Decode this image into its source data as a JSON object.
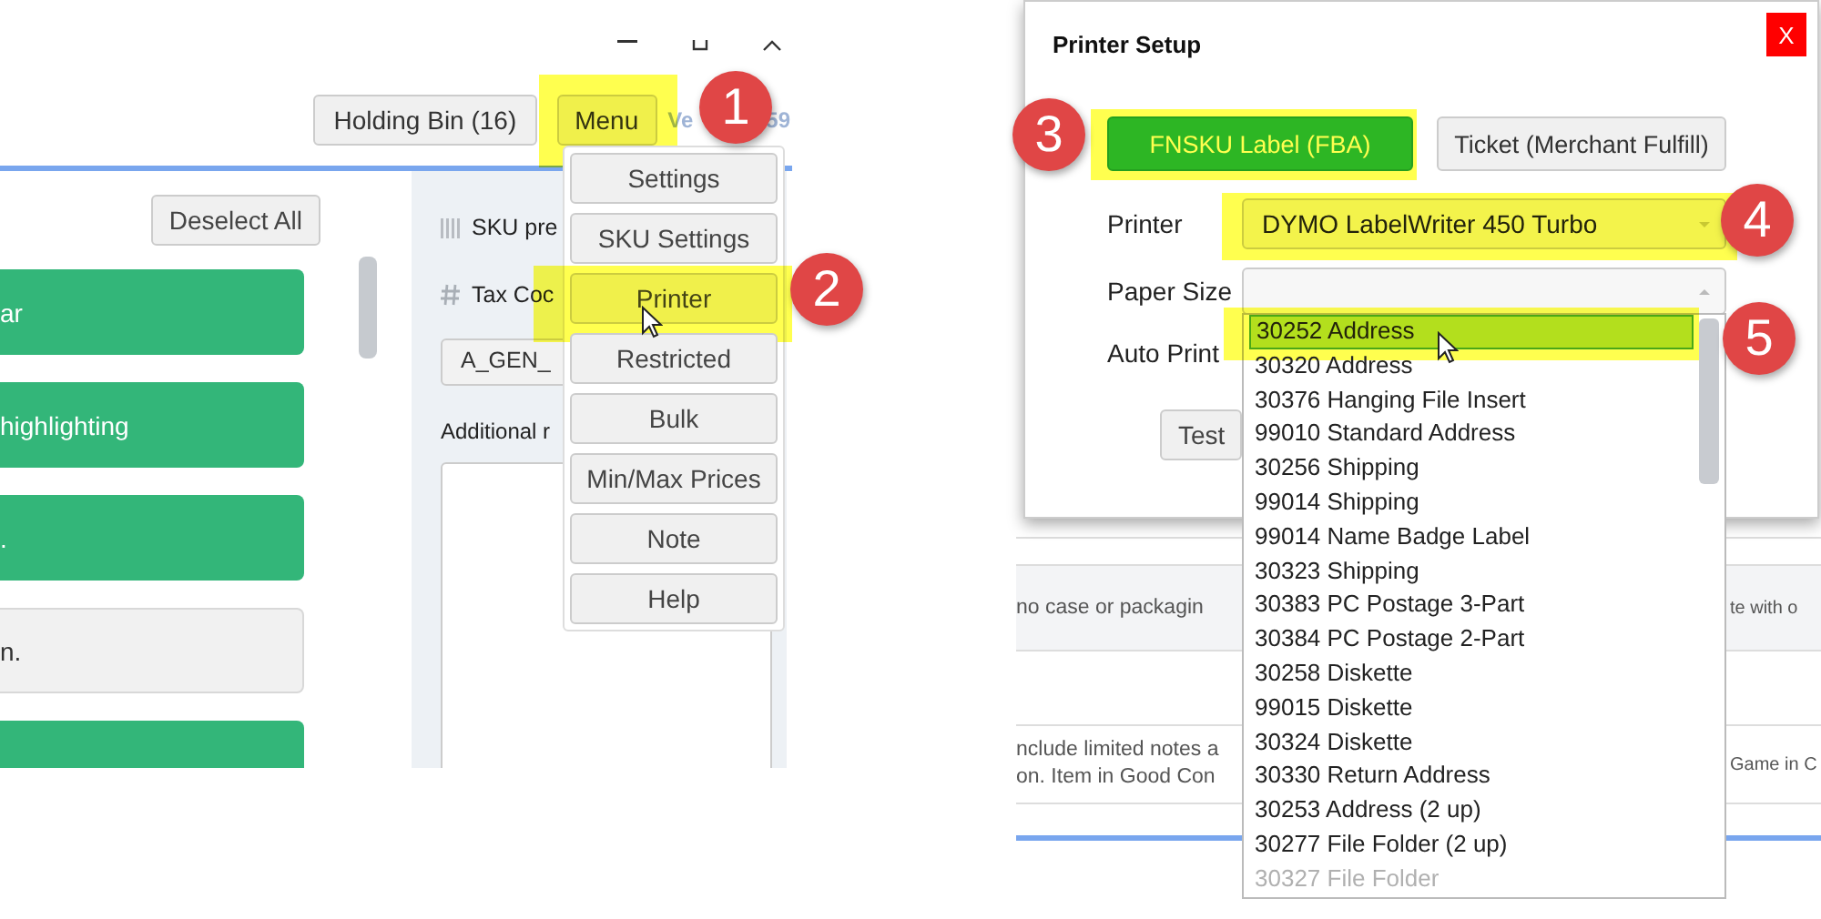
{
  "left_window": {
    "toolbar": {
      "buttons": [
        {
          "label": "Holding Bin (16)",
          "highlighted": false
        },
        {
          "label": "Menu",
          "highlighted": true
        }
      ],
      "version_text": [
        "Ve",
        "59"
      ]
    },
    "deselect_button": "Deselect All",
    "list_items": [
      {
        "text": "ar",
        "selected": true
      },
      {
        "text": "highlighting",
        "selected": true
      },
      {
        "text": ".",
        "selected": true
      },
      {
        "text": "n.",
        "selected": false
      },
      {
        "selected": true
      }
    ],
    "form": {
      "sku_label": "SKU pre",
      "tax_label": "Tax Coc",
      "tax_code_value": "A_GEN_",
      "notes_label": "Additional r"
    },
    "menu": {
      "items": [
        {
          "label": "Settings",
          "highlighted": false
        },
        {
          "label": "SKU Settings",
          "highlighted": false
        },
        {
          "label": "Printer",
          "highlighted": true
        },
        {
          "label": "Restricted",
          "highlighted": false
        },
        {
          "label": "Bulk",
          "highlighted": false
        },
        {
          "label": "Min/Max Prices",
          "highlighted": false
        },
        {
          "label": "Note",
          "highlighted": false
        },
        {
          "label": "Help",
          "highlighted": false
        }
      ]
    }
  },
  "right_window": {
    "background_rows": [
      {
        "left_lines": [
          "no case or packagin"
        ],
        "right": "te with o",
        "shaded": true
      },
      {
        "left_lines": [
          "nclude limited notes a",
          "on. Item in Good Con"
        ],
        "right": "Game in C",
        "shaded": false
      }
    ],
    "printer_dialog": {
      "title": "Printer Setup",
      "close_label": "X",
      "label_types": [
        {
          "label": "FNSKU Label (FBA)",
          "selected": true,
          "highlighted": true
        },
        {
          "label": "Ticket (Merchant Fulfill)",
          "selected": false,
          "highlighted": false
        }
      ],
      "printer_label": "Printer",
      "printer_value": "DYMO LabelWriter 450 Turbo",
      "printer_highlighted": true,
      "paper_label": "Paper Size",
      "auto_print_label": "Auto Print",
      "test_button": "Test",
      "paper_options": [
        {
          "label": "30252 Address",
          "selected": true,
          "dimmed": false
        },
        {
          "label": "30320 Address",
          "selected": false,
          "dimmed": false
        },
        {
          "label": "30376 Hanging File Insert",
          "selected": false,
          "dimmed": false
        },
        {
          "label": "99010 Standard Address",
          "selected": false,
          "dimmed": false
        },
        {
          "label": "30256 Shipping",
          "selected": false,
          "dimmed": false
        },
        {
          "label": "99014 Shipping",
          "selected": false,
          "dimmed": false
        },
        {
          "label": "99014 Name Badge Label",
          "selected": false,
          "dimmed": false
        },
        {
          "label": "30323 Shipping",
          "selected": false,
          "dimmed": false
        },
        {
          "label": "30383 PC Postage 3-Part",
          "selected": false,
          "dimmed": false
        },
        {
          "label": "30384 PC Postage 2-Part",
          "selected": false,
          "dimmed": false
        },
        {
          "label": "30258 Diskette",
          "selected": false,
          "dimmed": false
        },
        {
          "label": "99015 Diskette",
          "selected": false,
          "dimmed": false
        },
        {
          "label": "30324 Diskette",
          "selected": false,
          "dimmed": false
        },
        {
          "label": "30330 Return Address",
          "selected": false,
          "dimmed": false
        },
        {
          "label": "30253 Address (2 up)",
          "selected": false,
          "dimmed": false
        },
        {
          "label": "30277 File Folder (2 up)",
          "selected": false,
          "dimmed": false
        },
        {
          "label": "30327 File Folder",
          "selected": false,
          "dimmed": true
        }
      ]
    }
  },
  "callouts": [
    "1",
    "2",
    "3",
    "4",
    "5"
  ]
}
